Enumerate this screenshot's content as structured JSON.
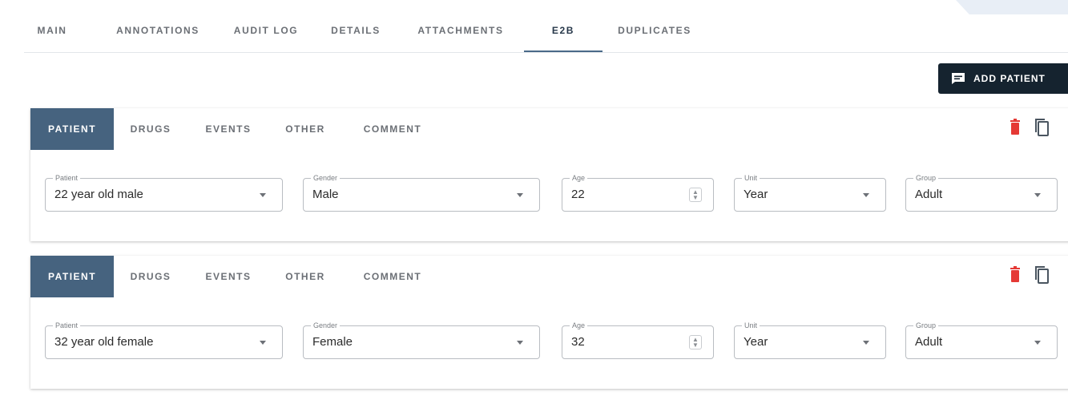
{
  "top_tabs": [
    "MAIN",
    "ANNOTATIONS",
    "AUDIT LOG",
    "DETAILS",
    "ATTACHMENTS",
    "E2B",
    "DUPLICATES"
  ],
  "active_top_tab": "E2B",
  "add_patient_label": "ADD PATIENT",
  "cards": [
    {
      "tabs": [
        "PATIENT",
        "DRUGS",
        "EVENTS",
        "OTHER",
        "COMMENT"
      ],
      "active_tab": "PATIENT",
      "fields": [
        {
          "label": "Patient",
          "value": "22 year old male",
          "control": "select"
        },
        {
          "label": "Gender",
          "value": "Male",
          "control": "select"
        },
        {
          "label": "Age",
          "value": "22",
          "control": "number"
        },
        {
          "label": "Unit",
          "value": "Year",
          "control": "select"
        },
        {
          "label": "Group",
          "value": "Adult",
          "control": "select"
        }
      ]
    },
    {
      "tabs": [
        "PATIENT",
        "DRUGS",
        "EVENTS",
        "OTHER",
        "COMMENT"
      ],
      "active_tab": "PATIENT",
      "fields": [
        {
          "label": "Patient",
          "value": "32 year old female",
          "control": "select"
        },
        {
          "label": "Gender",
          "value": "Female",
          "control": "select"
        },
        {
          "label": "Age",
          "value": "32",
          "control": "number"
        },
        {
          "label": "Unit",
          "value": "Year",
          "control": "select"
        },
        {
          "label": "Group",
          "value": "Adult",
          "control": "select"
        }
      ]
    }
  ],
  "icons": {
    "add": "comment-add-icon",
    "delete": "trash-icon",
    "copy": "copy-icon",
    "dropdown": "caret-down-icon",
    "spinner": "number-spinner-icon"
  },
  "colors": {
    "primary_dark": "#15232f",
    "active_tab_bg": "#46637f",
    "delete_red": "#e53935"
  }
}
